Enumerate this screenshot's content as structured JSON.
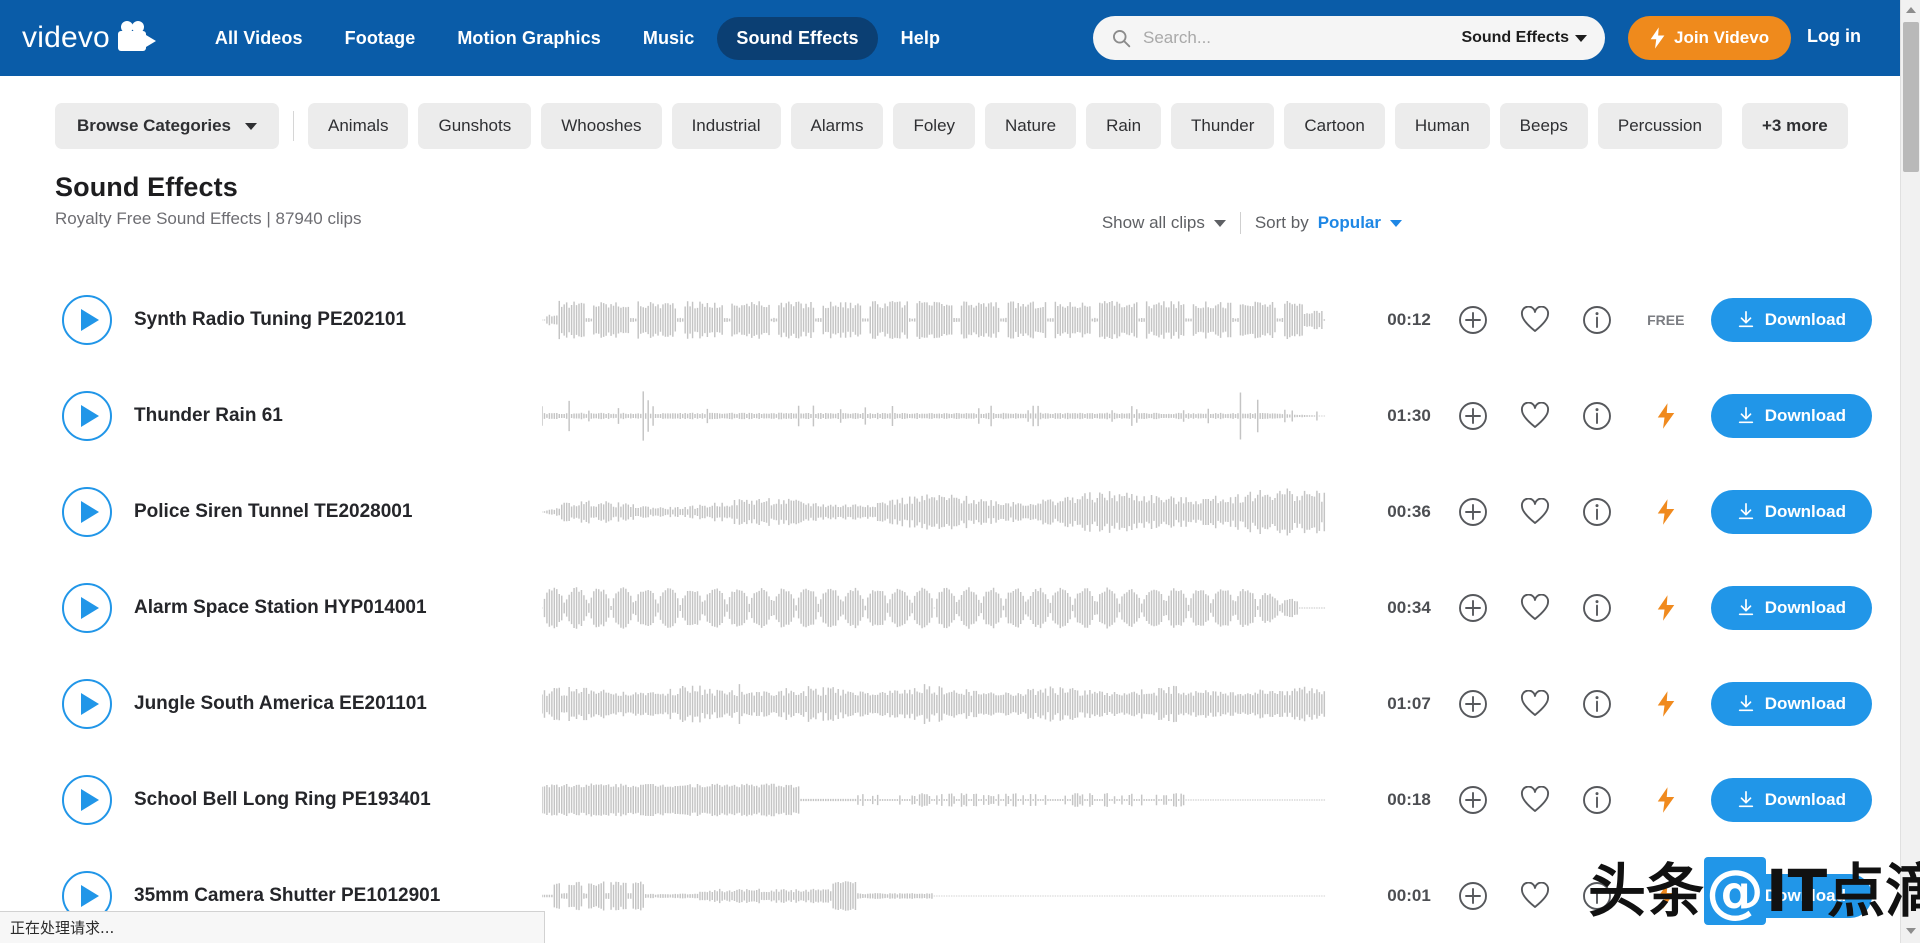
{
  "header": {
    "logo_text": "videvo",
    "logo_icon": "video-camera-icon",
    "nav": [
      {
        "label": "All Videos",
        "active": false
      },
      {
        "label": "Footage",
        "active": false
      },
      {
        "label": "Motion Graphics",
        "active": false
      },
      {
        "label": "Music",
        "active": false
      },
      {
        "label": "Sound Effects",
        "active": true
      },
      {
        "label": "Help",
        "active": false
      }
    ],
    "search": {
      "placeholder": "Search...",
      "value": "",
      "icon": "search-icon",
      "category": "Sound Effects",
      "caret_icon": "chevron-down-icon"
    },
    "join_label": "Join Videvo",
    "join_icon": "lightning-bolt-icon",
    "login_label": "Log in",
    "bg_color": "#0a5ca8",
    "accent_orange": "#ef8a1c"
  },
  "categories": {
    "browse_label": "Browse Categories",
    "browse_caret": "chevron-down-icon",
    "chips": [
      "Animals",
      "Gunshots",
      "Whooshes",
      "Industrial",
      "Alarms",
      "Foley",
      "Nature",
      "Rain",
      "Thunder",
      "Cartoon",
      "Human",
      "Beeps",
      "Percussion"
    ],
    "more_label": "+3 more"
  },
  "page": {
    "title": "Sound Effects",
    "subtitle": "Royalty Free Sound Effects | 87940 clips",
    "show_label": "Show all clips",
    "sort_prefix": "Sort by",
    "sort_value": "Popular"
  },
  "tracks": [
    {
      "title": "Synth Radio Tuning PE202101",
      "duration": "00:12",
      "badge": "FREE",
      "badge_type": "free",
      "download": "Download",
      "wave": "chunky"
    },
    {
      "title": "Thunder Rain 61",
      "duration": "01:30",
      "badge": "",
      "badge_type": "bolt",
      "download": "Download",
      "wave": "thin-spikes"
    },
    {
      "title": "Police Siren Tunnel TE2028001",
      "duration": "00:36",
      "badge": "",
      "badge_type": "bolt",
      "download": "Download",
      "wave": "dense-swell"
    },
    {
      "title": "Alarm Space Station HYP014001",
      "duration": "00:34",
      "badge": "",
      "badge_type": "bolt",
      "download": "Download",
      "wave": "pulses"
    },
    {
      "title": "Jungle South America EE201101",
      "duration": "01:07",
      "badge": "",
      "badge_type": "bolt",
      "download": "Download",
      "wave": "dense-even"
    },
    {
      "title": "School Bell Long Ring PE193401",
      "duration": "00:18",
      "badge": "",
      "badge_type": "bolt",
      "download": "Download",
      "wave": "front-block"
    },
    {
      "title": "35mm Camera Shutter PE1012901",
      "duration": "00:01",
      "badge": "",
      "badge_type": "bolt",
      "download": "Download",
      "wave": "short-burst"
    }
  ],
  "row_icons": {
    "play": "play-icon",
    "add": "plus-circle-icon",
    "favorite": "heart-icon",
    "info": "info-circle-icon",
    "download": "download-icon",
    "premium": "lightning-bolt-icon"
  },
  "watermark": {
    "text_left": "头条",
    "text_at": "@",
    "text_right": "IT点滴"
  },
  "status_bar": {
    "text": "正在处理请求..."
  },
  "scrollbar": {
    "up_icon": "chevron-up-icon",
    "down_icon": "chevron-down-icon"
  }
}
